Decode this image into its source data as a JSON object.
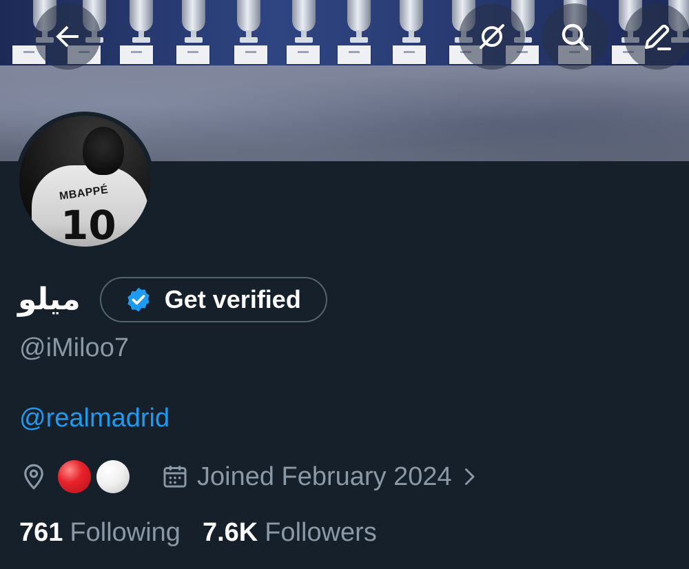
{
  "header": {
    "back_icon": "arrow-left-icon",
    "grok_icon": "grok-icon",
    "search_icon": "search-icon",
    "compose_icon": "compose-icon"
  },
  "profile": {
    "display_name": "ميلو",
    "get_verified_label": "Get verified",
    "handle": "@iMiloo7",
    "bio": "@realmadrid",
    "location_emoji": [
      "red-circle",
      "white-circle"
    ],
    "joined": "Joined February 2024",
    "following_count": "761",
    "following_label": "Following",
    "followers_count": "7.6K",
    "followers_label": "Followers"
  },
  "colors": {
    "background": "#15202b",
    "accent": "#1d9bf0",
    "muted": "#8b98a5",
    "verified_badge": "#1d9bf0"
  }
}
